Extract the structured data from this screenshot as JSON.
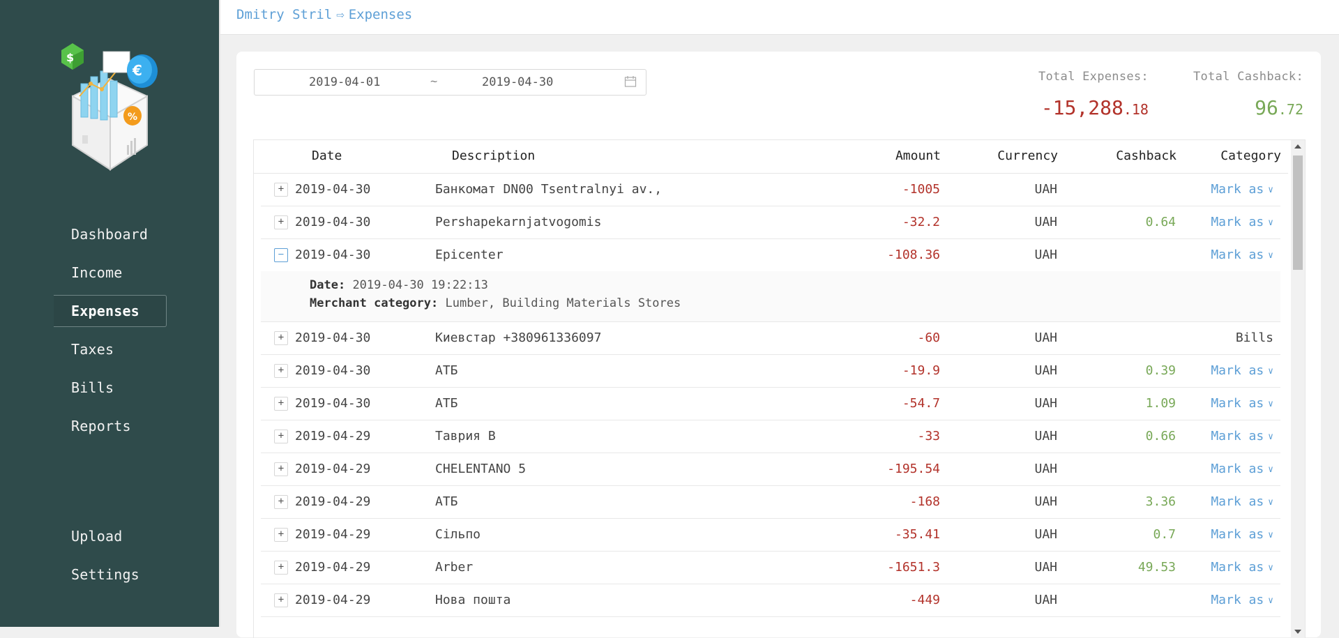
{
  "sidebar": {
    "nav": [
      {
        "label": "Dashboard"
      },
      {
        "label": "Income"
      },
      {
        "label": "Expenses"
      },
      {
        "label": "Taxes"
      },
      {
        "label": "Bills"
      },
      {
        "label": "Reports"
      }
    ],
    "bottom": [
      {
        "label": "Upload"
      },
      {
        "label": "Settings"
      }
    ],
    "active": "Expenses"
  },
  "header": {
    "breadcrumb": [
      "Dmitry Stril",
      "Expenses"
    ],
    "separator": "⇨"
  },
  "filters": {
    "start_date": "2019-04-01",
    "range_separator": "~",
    "end_date": "2019-04-30",
    "calendar_icon": "calendar-icon"
  },
  "totals": {
    "expenses_label": "Total Expenses:",
    "expenses_int": "-15,288",
    "expenses_dec": ".18",
    "cashback_label": "Total Cashback:",
    "cashback_int": "96",
    "cashback_dec": ".72"
  },
  "table": {
    "columns": {
      "date": "Date",
      "description": "Description",
      "amount": "Amount",
      "currency": "Currency",
      "cashback": "Cashback",
      "category": "Category"
    },
    "rows": [
      {
        "expander": "+",
        "date": "2019-04-30",
        "description": "Банкомат DN00 Tsentralnyi av.,",
        "amount": "-1005",
        "currency": "UAH",
        "cashback": "",
        "category": "Mark as"
      },
      {
        "expander": "+",
        "date": "2019-04-30",
        "description": "Pershapekarnjatvogomis",
        "amount": "-32.2",
        "currency": "UAH",
        "cashback": "0.64",
        "category": "Mark as"
      },
      {
        "expander": "−",
        "date": "2019-04-30",
        "description": "Epicenter",
        "amount": "-108.36",
        "currency": "UAH",
        "cashback": "",
        "category": "Mark as"
      },
      {
        "expander": "+",
        "date": "2019-04-30",
        "description": "Киевстар +380961336097",
        "amount": "-60",
        "currency": "UAH",
        "cashback": "",
        "category": "Bills"
      },
      {
        "expander": "+",
        "date": "2019-04-30",
        "description": "АТБ",
        "amount": "-19.9",
        "currency": "UAH",
        "cashback": "0.39",
        "category": "Mark as"
      },
      {
        "expander": "+",
        "date": "2019-04-30",
        "description": "АТБ",
        "amount": "-54.7",
        "currency": "UAH",
        "cashback": "1.09",
        "category": "Mark as"
      },
      {
        "expander": "+",
        "date": "2019-04-29",
        "description": "Таврия В",
        "amount": "-33",
        "currency": "UAH",
        "cashback": "0.66",
        "category": "Mark as"
      },
      {
        "expander": "+",
        "date": "2019-04-29",
        "description": "CHELENTANO 5",
        "amount": "-195.54",
        "currency": "UAH",
        "cashback": "",
        "category": "Mark as"
      },
      {
        "expander": "+",
        "date": "2019-04-29",
        "description": "АТБ",
        "amount": "-168",
        "currency": "UAH",
        "cashback": "3.36",
        "category": "Mark as"
      },
      {
        "expander": "+",
        "date": "2019-04-29",
        "description": "Сільпо",
        "amount": "-35.41",
        "currency": "UAH",
        "cashback": "0.7",
        "category": "Mark as"
      },
      {
        "expander": "+",
        "date": "2019-04-29",
        "description": "Arber",
        "amount": "-1651.3",
        "currency": "UAH",
        "cashback": "49.53",
        "category": "Mark as"
      },
      {
        "expander": "+",
        "date": "2019-04-29",
        "description": "Нова пошта",
        "amount": "-449",
        "currency": "UAH",
        "cashback": "",
        "category": "Mark as"
      }
    ],
    "expanded_detail": {
      "date_label": "Date:",
      "date_value": "2019-04-30 19:22:13",
      "merchant_label": "Merchant category:",
      "merchant_value": "Lumber, Building Materials Stores"
    }
  },
  "colors": {
    "sidebar_bg": "#2f4b4b",
    "link": "#5d9fd6",
    "negative": "#b2322a",
    "positive": "#78a857"
  }
}
